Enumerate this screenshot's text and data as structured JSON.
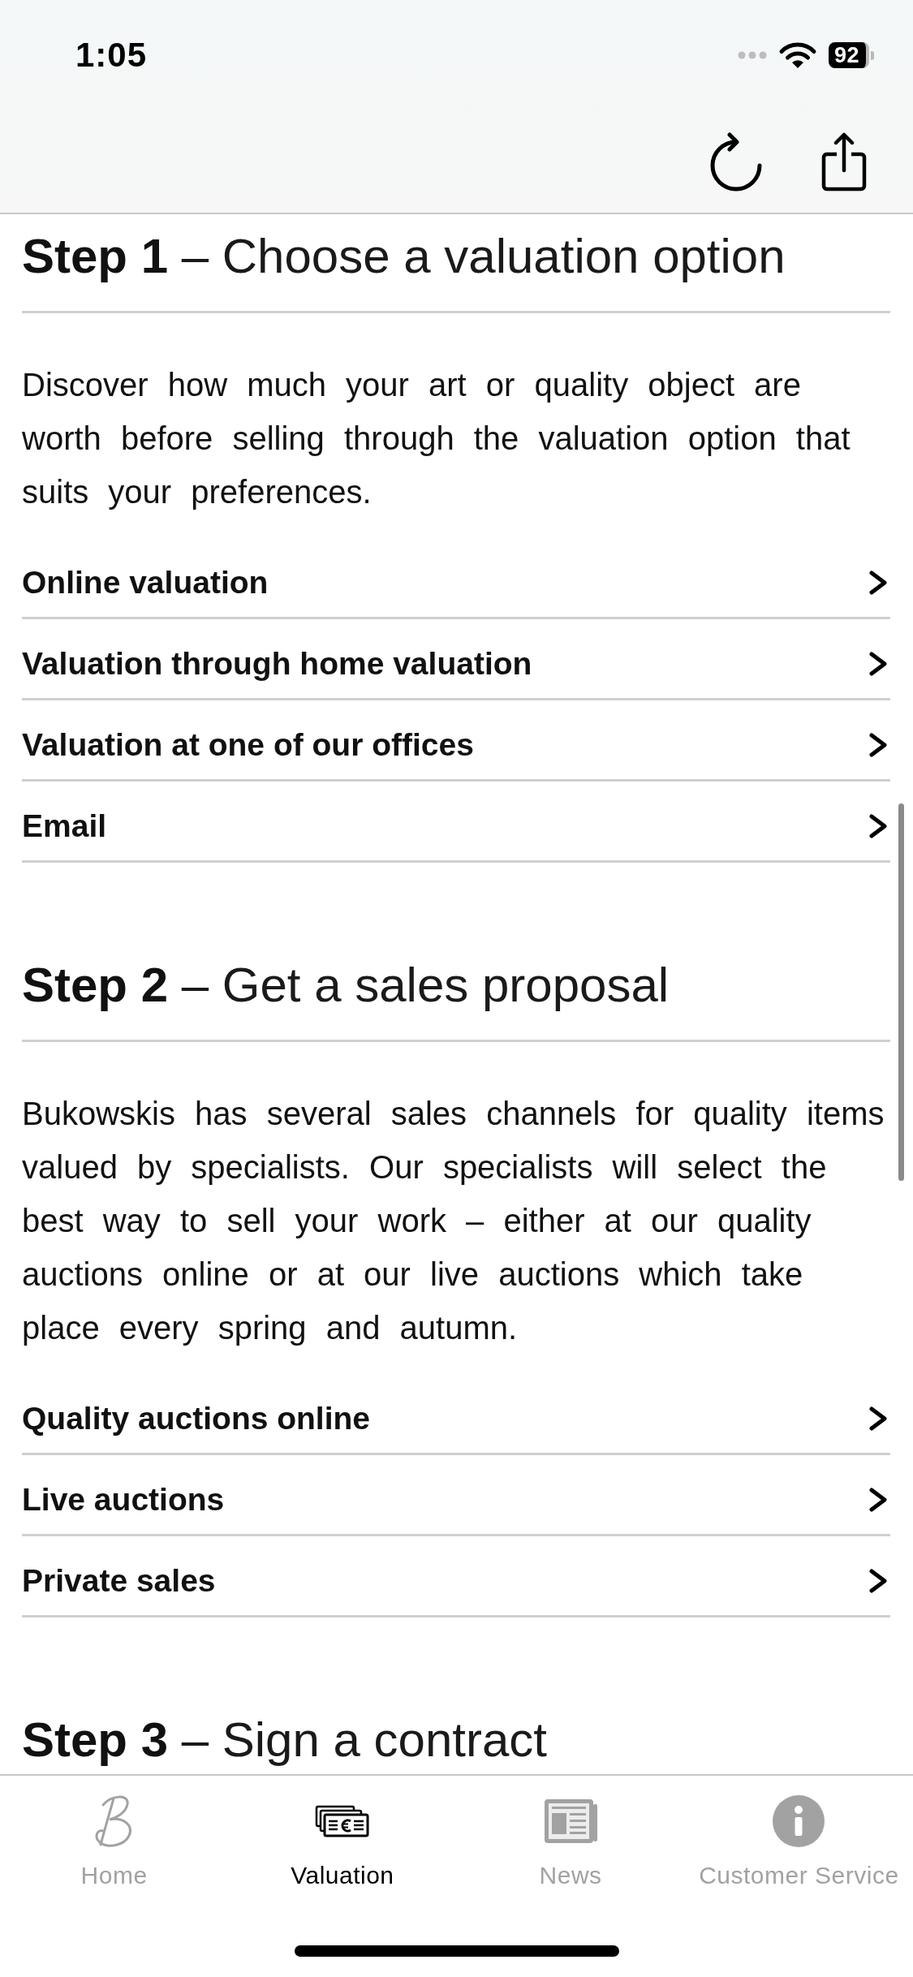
{
  "status_bar": {
    "time": "1:05",
    "battery": "92"
  },
  "sections": [
    {
      "heading": "**Step 1** – Choose a valuation option",
      "body": "Discover how much your art or quality object are worth before selling through the valuation option that suits your preferences.",
      "links": [
        "Online valuation",
        "Valuation through home valuation",
        "Valuation at one of our offices",
        "Email"
      ]
    },
    {
      "heading": "**Step 2** – Get a sales proposal",
      "body": "Bukowskis has several sales channels for quality items valued by specialists. Our specialists will select the best way to sell your work – either at our quality auctions online or at our live auctions which take place every spring and autumn.",
      "links": [
        "Quality auctions online",
        "Live auctions",
        "Private sales"
      ]
    },
    {
      "heading": "**Step 3** – Sign a contract"
    }
  ],
  "tabs": [
    {
      "label": "Home",
      "selected": false
    },
    {
      "label": "Valuation",
      "selected": true
    },
    {
      "label": "News",
      "selected": false
    },
    {
      "label": "Customer Service",
      "selected": false
    }
  ]
}
